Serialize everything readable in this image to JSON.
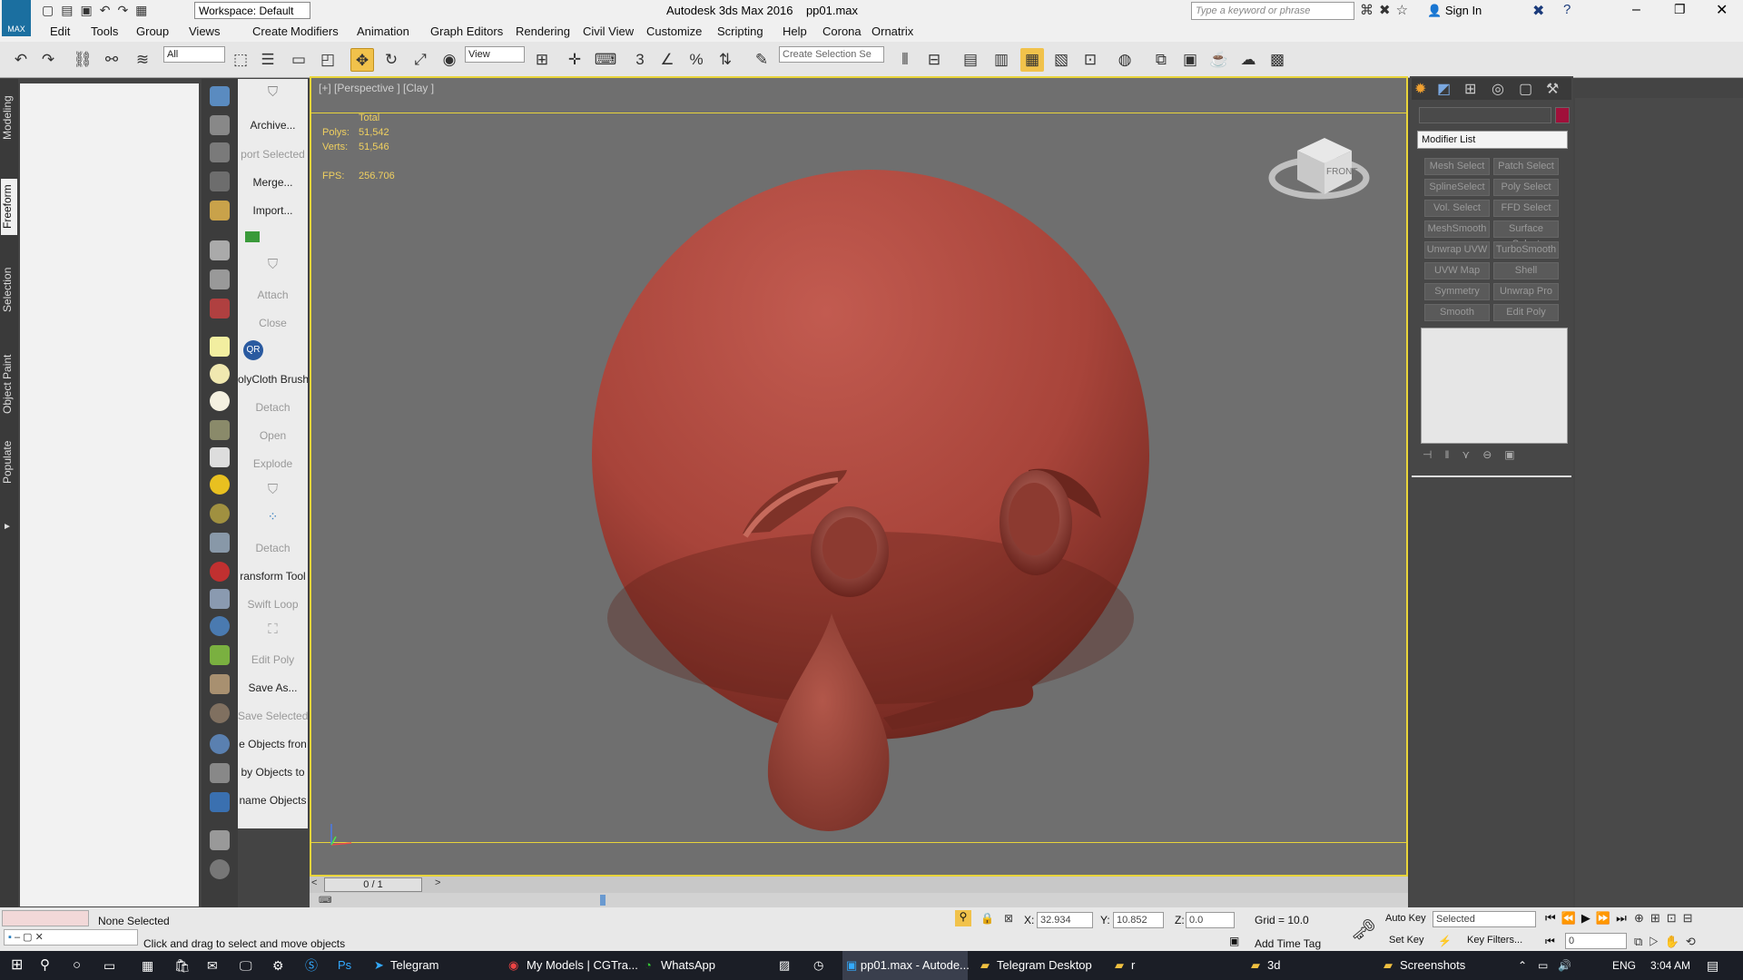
{
  "titlebar": {
    "app_title": "Autodesk 3ds Max 2016",
    "file_name": "pp01.max",
    "workspace": "Workspace: Default",
    "search_placeholder": "Type a keyword or phrase",
    "sign_in": "Sign In",
    "logo": "MAX"
  },
  "menu": [
    "Edit",
    "Tools",
    "Group",
    "Views",
    "Create",
    "Modifiers",
    "Animation",
    "Graph Editors",
    "Rendering",
    "Civil View",
    "Customize",
    "Scripting",
    "Help",
    "Corona",
    "Ornatrix"
  ],
  "toolbar": {
    "filter_select": "All",
    "coord_select": "View",
    "selection_set": "Create Selection Se",
    "snap_3": "3",
    "percent": "%"
  },
  "ribbon_tabs": [
    "Modeling",
    "Freeform",
    "Selection",
    "Object Paint",
    "Populate"
  ],
  "text_col": [
    {
      "label": "Archive...",
      "dim": false
    },
    {
      "label": "port Selected",
      "dim": true
    },
    {
      "label": "Merge...",
      "dim": false
    },
    {
      "label": "Import...",
      "dim": false
    },
    {
      "label": "",
      "dim": false
    },
    {
      "label": "",
      "dim": false
    },
    {
      "label": "Attach",
      "dim": true
    },
    {
      "label": "Close",
      "dim": true
    },
    {
      "label": "QR",
      "dim": false
    },
    {
      "label": "olyCloth Brush",
      "dim": false
    },
    {
      "label": "Detach",
      "dim": true
    },
    {
      "label": "Open",
      "dim": true
    },
    {
      "label": "Explode",
      "dim": true
    },
    {
      "label": "",
      "dim": false
    },
    {
      "label": "",
      "dim": false
    },
    {
      "label": "Detach",
      "dim": true
    },
    {
      "label": "ransform Tool",
      "dim": false
    },
    {
      "label": "Swift Loop",
      "dim": true
    },
    {
      "label": "",
      "dim": false
    },
    {
      "label": "Edit Poly",
      "dim": true
    },
    {
      "label": "Save As...",
      "dim": false
    },
    {
      "label": "Save Selected",
      "dim": true
    },
    {
      "label": "e Objects fron",
      "dim": false
    },
    {
      "label": "by Objects to",
      "dim": false
    },
    {
      "label": "name Objects",
      "dim": false
    }
  ],
  "viewport": {
    "label": "[+] [Perspective ] [Clay ]",
    "stats_total": "Total",
    "polys_label": "Polys:",
    "polys_value": "51,542",
    "verts_label": "Verts:",
    "verts_value": "51,546",
    "fps_label": "FPS:",
    "fps_value": "256.706",
    "viewcube": "FRONT",
    "frame_counter": "0 / 1"
  },
  "command_panel": {
    "modifier_list": "Modifier List",
    "color": "#a0103a",
    "buttons": [
      "Mesh Select",
      "Patch Select",
      "SplineSelect",
      "Poly Select",
      "Vol. Select",
      "FFD Select",
      "MeshSmooth",
      "Surface Select",
      "Unwrap UVW",
      "TurboSmooth",
      "UVW Map",
      "Shell",
      "Symmetry",
      "Unwrap Pro",
      "Smooth",
      "Edit Poly"
    ]
  },
  "status": {
    "selection": "None Selected",
    "prompt": "Click and drag to select and move objects",
    "x_label": "X:",
    "x_value": "32.934",
    "y_label": "Y:",
    "y_value": "10.852",
    "z_label": "Z:",
    "z_value": "0.0",
    "grid": "Grid = 10.0",
    "add_time_tag": "Add Time Tag",
    "auto_key": "Auto Key",
    "set_key": "Set Key",
    "key_mode": "Selected",
    "key_filters": "Key Filters...",
    "frame": "0"
  },
  "taskbar": {
    "items": [
      "Telegram",
      "My Models | CGTra...",
      "WhatsApp",
      "pp01.max - Autode...",
      "Telegram Desktop",
      "r",
      "3d",
      "Screenshots"
    ],
    "lang": "ENG",
    "time": "3:04 AM"
  }
}
